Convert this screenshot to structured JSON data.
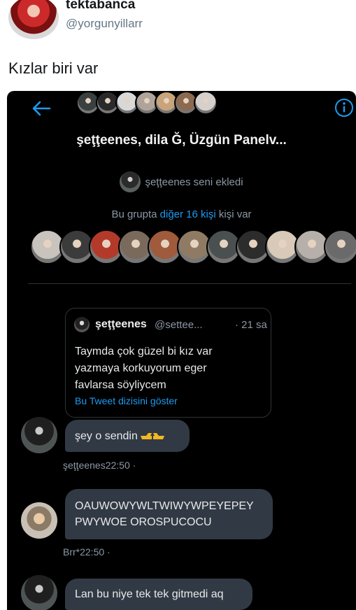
{
  "tweet": {
    "author_name": "tektabanca",
    "author_handle": "@yorgunyillarr",
    "text": "Kızlar biri var"
  },
  "dm": {
    "group_title": "şeţţeenes, dila Ğ, Üzgün Panelv...",
    "added_text": "şeţţeenes seni ekledi",
    "members_prefix": "Bu grupta",
    "members_link": "diğer 16 kişi",
    "members_suffix": "kişi var",
    "header_avatar_colors": [
      "#3a3f3f",
      "#2a2a2a",
      "#d8d8d8",
      "#b0a49a",
      "#c9a37a",
      "#8b6a50",
      "#d5d0cc"
    ],
    "member_avatar_colors": [
      "#c9c3bd",
      "#3b3b3b",
      "#b33a2a",
      "#7a6a5c",
      "#a05a3c",
      "#8f7b64",
      "#4a5050",
      "#2c2c2c",
      "#d8c9b8",
      "#b7b0aa",
      "#6a6a6a"
    ],
    "quote": {
      "name": "şeţţeenes",
      "handle": "@settee...",
      "time": "· 21 sa",
      "text": "Taymda çok güzel bi kız var\nyazmaya korkuyorum eger\nfavlarsa söyliycem",
      "link": "Bu Tweet dizisini göster"
    },
    "messages": [
      {
        "text": "şey o sendin",
        "emoji": "pointing-hands-emoji",
        "meta": "şeţţeenes22:50 ·"
      },
      {
        "text": "OAUWOWYWLTWIWYWPEYEPEY\nPWYWOE OROSPUCOCU",
        "meta": "Brr*22:50 ·"
      },
      {
        "text": "Lan bu niye tek tek gitmedi aq"
      }
    ]
  },
  "colors": {
    "accent": "#1d9bf0",
    "bubble": "#313a44",
    "background": "#000000"
  }
}
